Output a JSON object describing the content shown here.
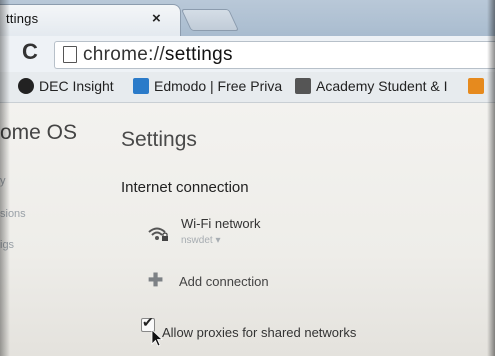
{
  "tab": {
    "title": "ttings",
    "close": "×"
  },
  "toolbar": {
    "reload_icon": "reload-icon",
    "url_scheme": "chrome://",
    "url_page": "settings"
  },
  "bookmarks": [
    {
      "label": "DEC Insight",
      "icon": "dec-nsw-icon",
      "color": "#222222"
    },
    {
      "label": "Edmodo | Free Priva",
      "icon": "edmodo-icon",
      "color": "#2b7bc9"
    },
    {
      "label": "Academy Student & I",
      "icon": "academy-icon",
      "color": "#555555"
    },
    {
      "label": "",
      "icon": "orange-bookmark-icon",
      "color": "#e68a1e"
    }
  ],
  "sidebar": {
    "title": "ome OS",
    "items": [
      "y",
      "sions",
      "igs"
    ]
  },
  "main": {
    "title": "Settings",
    "section_title": "Internet connection",
    "wifi_label": "Wi-Fi network",
    "wifi_network": "nswdet ▾",
    "add_connection": "Add connection",
    "proxy_label": "Allow proxies for shared networks",
    "proxy_checked": true
  }
}
